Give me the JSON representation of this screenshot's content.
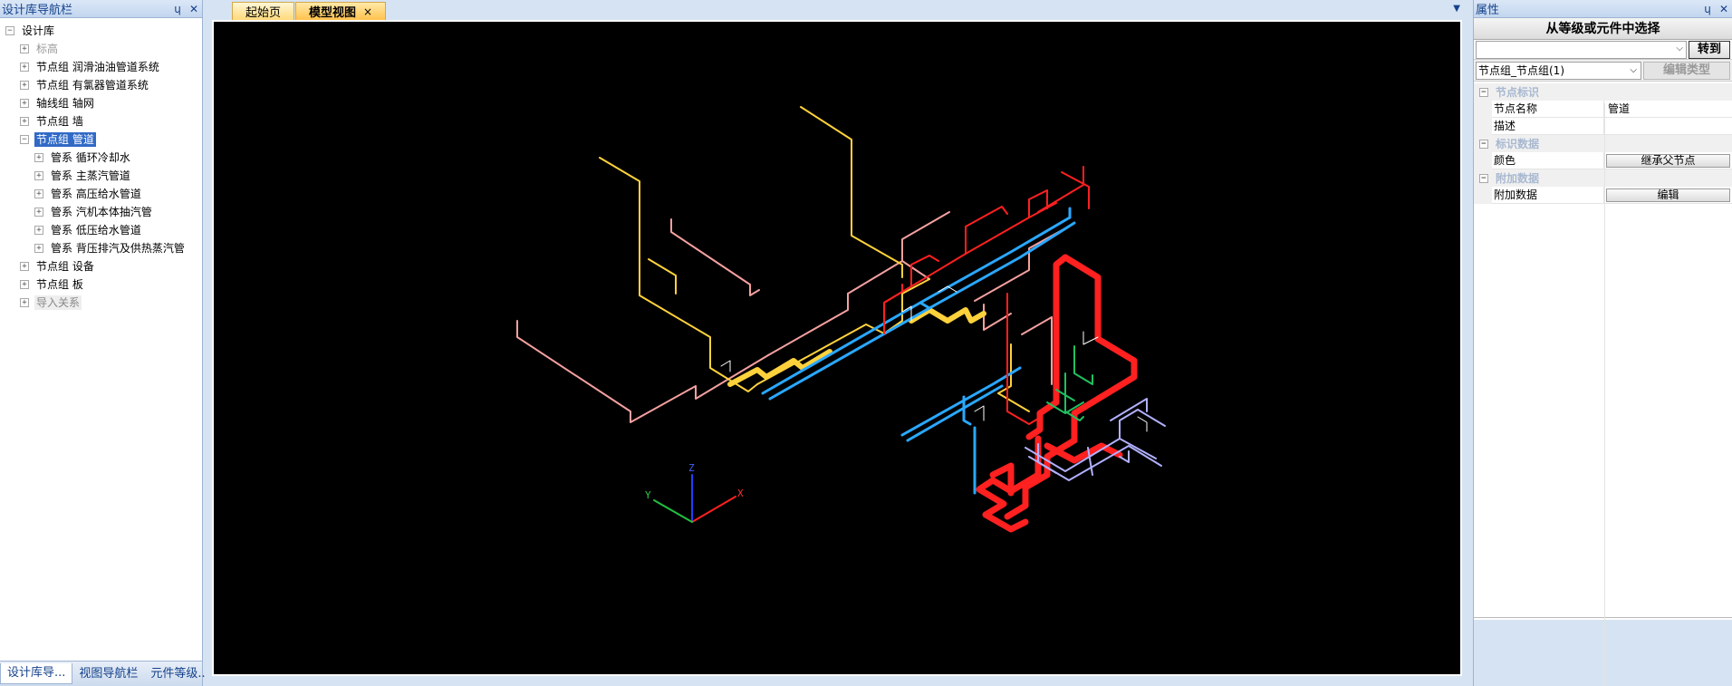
{
  "left_panel": {
    "title": "设计库导航栏",
    "pin_icon": "ɥ",
    "close_icon": "✕",
    "tree": [
      {
        "level": 0,
        "exp": "−",
        "label": "设计库",
        "style": ""
      },
      {
        "level": 1,
        "exp": "+",
        "label": "标高",
        "style": "gray"
      },
      {
        "level": 1,
        "exp": "+",
        "label": "节点组 润滑油油管道系统",
        "style": ""
      },
      {
        "level": 1,
        "exp": "+",
        "label": "节点组 有氯器管道系统",
        "style": ""
      },
      {
        "level": 1,
        "exp": "+",
        "label": "轴线组 轴网",
        "style": ""
      },
      {
        "level": 1,
        "exp": "+",
        "label": "节点组 墙",
        "style": ""
      },
      {
        "level": 1,
        "exp": "−",
        "label": "节点组 管道",
        "style": "sel"
      },
      {
        "level": 2,
        "exp": "+",
        "label": "管系 循环冷却水",
        "style": ""
      },
      {
        "level": 2,
        "exp": "+",
        "label": "管系 主蒸汽管道",
        "style": ""
      },
      {
        "level": 2,
        "exp": "+",
        "label": "管系 高压给水管道",
        "style": ""
      },
      {
        "level": 2,
        "exp": "+",
        "label": "管系 汽机本体抽汽管",
        "style": ""
      },
      {
        "level": 2,
        "exp": "+",
        "label": "管系 低压给水管道",
        "style": ""
      },
      {
        "level": 2,
        "exp": "+",
        "label": "管系 背压排汽及供热蒸汽管",
        "style": ""
      },
      {
        "level": 1,
        "exp": "+",
        "label": "节点组 设备",
        "style": ""
      },
      {
        "level": 1,
        "exp": "+",
        "label": "节点组 板",
        "style": ""
      },
      {
        "level": 1,
        "exp": "+",
        "label": "导入关系",
        "style": "boxed"
      }
    ],
    "bottom_tabs": [
      "设计库导...",
      "视图导航栏",
      "元件等级..."
    ]
  },
  "doc": {
    "tabs": [
      {
        "label": "起始页",
        "active": false
      },
      {
        "label": "模型视图",
        "active": true
      }
    ],
    "tab_close": "×",
    "menu_arrow": "▼",
    "axes": {
      "x": "X",
      "y": "Y",
      "z": "Z"
    }
  },
  "right_panel": {
    "title": "属性",
    "pin_icon": "ɥ",
    "close_icon": "✕",
    "select_title": "从等级或元件中选择",
    "goto_label": "转到",
    "type_value": "节点组_节点组(1)",
    "edit_type_label": "编辑类型",
    "categories": [
      {
        "label": "节点标识",
        "rows": [
          {
            "name": "节点名称",
            "value": "管道",
            "button": false
          },
          {
            "name": "描述",
            "value": "",
            "button": false
          }
        ]
      },
      {
        "label": "标识数据",
        "rows": [
          {
            "name": "颜色",
            "value": "继承父节点",
            "button": true
          }
        ]
      },
      {
        "label": "附加数据",
        "rows": [
          {
            "name": "附加数据",
            "value": "编辑",
            "button": true
          }
        ]
      }
    ]
  },
  "colors": {
    "cooling_water": "#f5a0a0",
    "main_steam": "#ff2020",
    "high_pressure_feed": "#ffd23c",
    "low_pressure_feed": "#2aa8ff",
    "extraction": "#b0b0ff",
    "green_pipe": "#20c060"
  }
}
